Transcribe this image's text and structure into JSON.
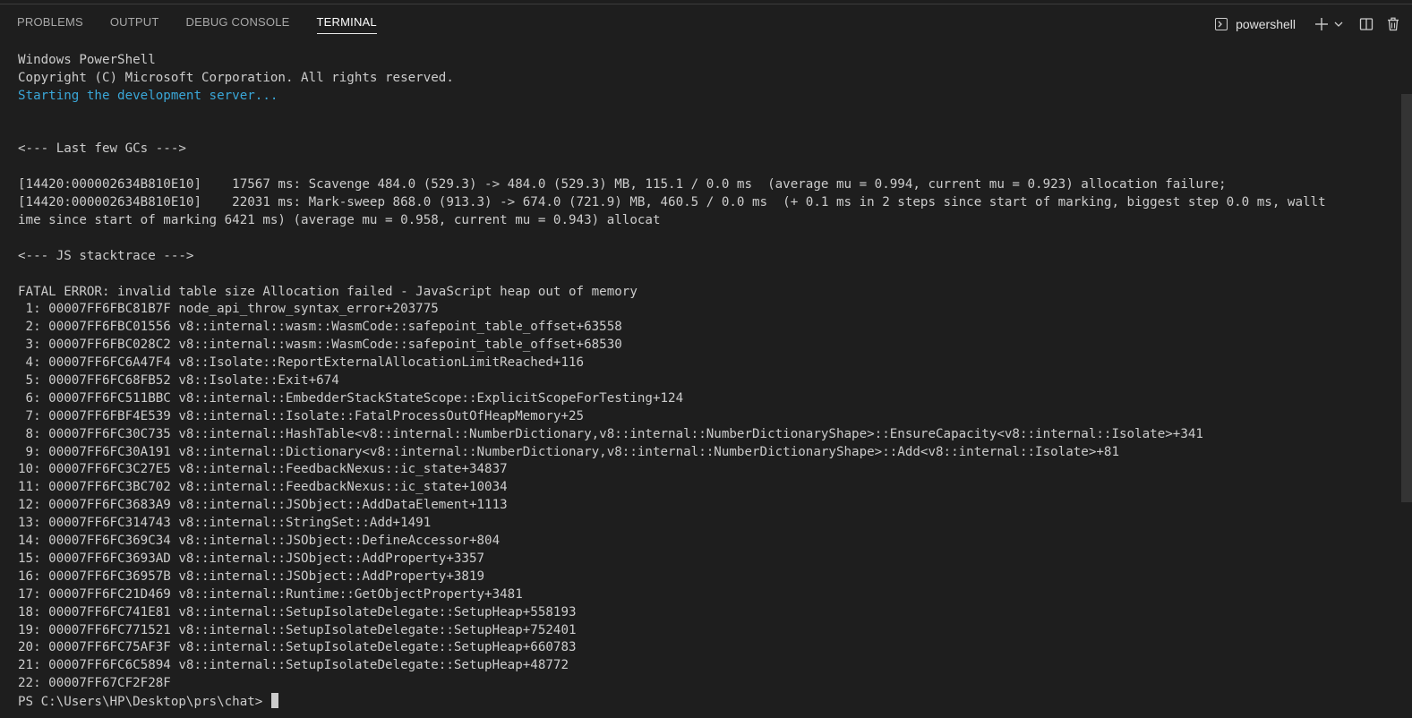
{
  "tabs": [
    {
      "label": "PROBLEMS",
      "active": false
    },
    {
      "label": "OUTPUT",
      "active": false
    },
    {
      "label": "DEBUG CONSOLE",
      "active": false
    },
    {
      "label": "TERMINAL",
      "active": true
    }
  ],
  "terminal_select": {
    "label": "powershell",
    "icon": "terminal-icon"
  },
  "header_icons": [
    "plus-icon",
    "chevron-down-icon",
    "split-editor-icon",
    "trash-icon"
  ],
  "terminal": {
    "lines": [
      {
        "text": "Windows PowerShell",
        "style": "normal"
      },
      {
        "text": "Copyright (C) Microsoft Corporation. All rights reserved.",
        "style": "normal"
      },
      {
        "text": "Starting the development server...",
        "style": "cyan"
      },
      {
        "text": "",
        "style": "normal"
      },
      {
        "text": "",
        "style": "normal"
      },
      {
        "text": "<--- Last few GCs --->",
        "style": "normal"
      },
      {
        "text": "",
        "style": "normal"
      },
      {
        "text": "[14420:000002634B810E10]    17567 ms: Scavenge 484.0 (529.3) -> 484.0 (529.3) MB, 115.1 / 0.0 ms  (average mu = 0.994, current mu = 0.923) allocation failure;",
        "style": "normal"
      },
      {
        "text": "[14420:000002634B810E10]    22031 ms: Mark-sweep 868.0 (913.3) -> 674.0 (721.9) MB, 460.5 / 0.0 ms  (+ 0.1 ms in 2 steps since start of marking, biggest step 0.0 ms, wallt",
        "style": "normal"
      },
      {
        "text": "ime since start of marking 6421 ms) (average mu = 0.958, current mu = 0.943) allocat",
        "style": "normal"
      },
      {
        "text": "",
        "style": "normal"
      },
      {
        "text": "<--- JS stacktrace --->",
        "style": "normal"
      },
      {
        "text": "",
        "style": "normal"
      },
      {
        "text": "FATAL ERROR: invalid table size Allocation failed - JavaScript heap out of memory",
        "style": "normal"
      },
      {
        "text": " 1: 00007FF6FBC81B7F node_api_throw_syntax_error+203775",
        "style": "normal"
      },
      {
        "text": " 2: 00007FF6FBC01556 v8::internal::wasm::WasmCode::safepoint_table_offset+63558",
        "style": "normal"
      },
      {
        "text": " 3: 00007FF6FBC028C2 v8::internal::wasm::WasmCode::safepoint_table_offset+68530",
        "style": "normal"
      },
      {
        "text": " 4: 00007FF6FC6A47F4 v8::Isolate::ReportExternalAllocationLimitReached+116",
        "style": "normal"
      },
      {
        "text": " 5: 00007FF6FC68FB52 v8::Isolate::Exit+674",
        "style": "normal"
      },
      {
        "text": " 6: 00007FF6FC511BBC v8::internal::EmbedderStackStateScope::ExplicitScopeForTesting+124",
        "style": "normal"
      },
      {
        "text": " 7: 00007FF6FBF4E539 v8::internal::Isolate::FatalProcessOutOfHeapMemory+25",
        "style": "normal"
      },
      {
        "text": " 8: 00007FF6FC30C735 v8::internal::HashTable<v8::internal::NumberDictionary,v8::internal::NumberDictionaryShape>::EnsureCapacity<v8::internal::Isolate>+341",
        "style": "normal"
      },
      {
        "text": " 9: 00007FF6FC30A191 v8::internal::Dictionary<v8::internal::NumberDictionary,v8::internal::NumberDictionaryShape>::Add<v8::internal::Isolate>+81",
        "style": "normal"
      },
      {
        "text": "10: 00007FF6FC3C27E5 v8::internal::FeedbackNexus::ic_state+34837",
        "style": "normal"
      },
      {
        "text": "11: 00007FF6FC3BC702 v8::internal::FeedbackNexus::ic_state+10034",
        "style": "normal"
      },
      {
        "text": "12: 00007FF6FC3683A9 v8::internal::JSObject::AddDataElement+1113",
        "style": "normal"
      },
      {
        "text": "13: 00007FF6FC314743 v8::internal::StringSet::Add+1491",
        "style": "normal"
      },
      {
        "text": "14: 00007FF6FC369C34 v8::internal::JSObject::DefineAccessor+804",
        "style": "normal"
      },
      {
        "text": "15: 00007FF6FC3693AD v8::internal::JSObject::AddProperty+3357",
        "style": "normal"
      },
      {
        "text": "16: 00007FF6FC36957B v8::internal::JSObject::AddProperty+3819",
        "style": "normal"
      },
      {
        "text": "17: 00007FF6FC21D469 v8::internal::Runtime::GetObjectProperty+3481",
        "style": "normal"
      },
      {
        "text": "18: 00007FF6FC741E81 v8::internal::SetupIsolateDelegate::SetupHeap+558193",
        "style": "normal"
      },
      {
        "text": "19: 00007FF6FC771521 v8::internal::SetupIsolateDelegate::SetupHeap+752401",
        "style": "normal"
      },
      {
        "text": "20: 00007FF6FC75AF3F v8::internal::SetupIsolateDelegate::SetupHeap+660783",
        "style": "normal"
      },
      {
        "text": "21: 00007FF6FC6C5894 v8::internal::SetupIsolateDelegate::SetupHeap+48772",
        "style": "normal"
      },
      {
        "text": "22: 00007FF67CF2F28F",
        "style": "normal"
      }
    ],
    "prompt": "PS C:\\Users\\HP\\Desktop\\prs\\chat> "
  }
}
